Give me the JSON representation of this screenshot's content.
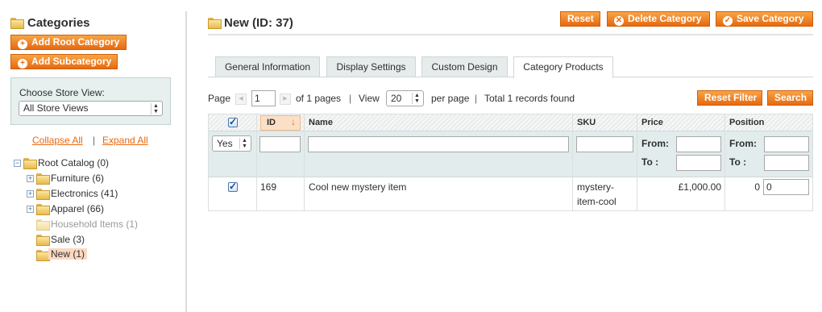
{
  "sidebar": {
    "title": "Categories",
    "add_root_label": "Add Root Category",
    "add_sub_label": "Add Subcategory",
    "store_view_label": "Choose Store View:",
    "store_view_value": "All Store Views",
    "collapse_all": "Collapse All",
    "separator": "|",
    "expand_all": "Expand All",
    "tree": {
      "root": "Root Catalog (0)",
      "furniture": "Furniture (6)",
      "electronics": "Electronics (41)",
      "apparel": "Apparel (66)",
      "household": "Household Items (1)",
      "sale": "Sale (3)",
      "new": "New (1)"
    }
  },
  "header": {
    "title": "New (ID: 37)",
    "reset_label": "Reset",
    "delete_label": "Delete Category",
    "save_label": "Save Category"
  },
  "tabs": [
    "General Information",
    "Display Settings",
    "Custom Design",
    "Category Products"
  ],
  "pager": {
    "page_label": "Page",
    "page_value": "1",
    "of_pages": "of 1 pages",
    "sep1": "|",
    "view_label": "View",
    "view_value": "20",
    "per_page": "per page",
    "sep2": "|",
    "total": "Total 1 records found",
    "reset_filter": "Reset Filter",
    "search": "Search"
  },
  "grid": {
    "columns": [
      "ID",
      "Name",
      "SKU",
      "Price",
      "Position"
    ],
    "filter": {
      "select_value": "Yes",
      "from_label": "From:",
      "to_label": "To :"
    },
    "rows": [
      {
        "id": "169",
        "name": "Cool new mystery item",
        "sku_line1": "mystery-",
        "sku_line2": "item-cool",
        "price": "£1,000.00",
        "position": "0",
        "position_input": "0"
      }
    ]
  },
  "colors": {
    "accent": "#e8690f",
    "filter_bg": "#e3ecec",
    "link": "#e8690f"
  }
}
